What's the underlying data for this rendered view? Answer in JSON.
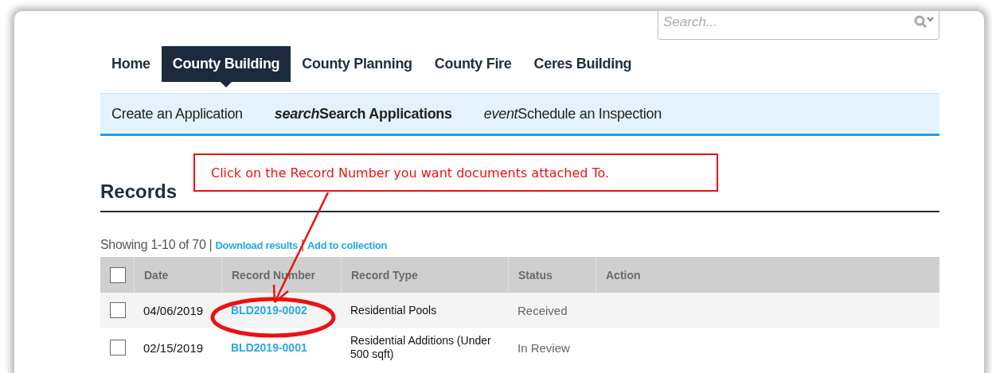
{
  "search": {
    "placeholder": "Search..."
  },
  "nav_tabs": [
    {
      "label": "Home",
      "selected": false
    },
    {
      "label": "County Building",
      "selected": true
    },
    {
      "label": "County Planning",
      "selected": false
    },
    {
      "label": "County Fire",
      "selected": false
    },
    {
      "label": "Ceres Building",
      "selected": false
    }
  ],
  "sub_nav": [
    {
      "label": "Create an Application",
      "selected": false
    },
    {
      "icon_word": "search",
      "label": "Search Applications",
      "selected": true
    },
    {
      "icon_word": "event",
      "label": "Schedule an Inspection",
      "selected": false
    }
  ],
  "records": {
    "title": "Records",
    "summary": "Showing 1-10 of 70 |",
    "links": [
      "Download results",
      "Add to collection"
    ],
    "link_separator": "|",
    "select_all_checked": false,
    "columns": [
      "Date",
      "Record Number",
      "Record Type",
      "Status",
      "Action"
    ],
    "rows": [
      {
        "checked": false,
        "date": "04/06/2019",
        "record_number": "BLD2019-0002",
        "record_type": "Residential Pools",
        "status": "Received"
      },
      {
        "checked": false,
        "date": "02/15/2019",
        "record_number": "BLD2019-0001",
        "record_type": "Residential Additions (Under 500 sqft)",
        "status": "In Review"
      }
    ]
  },
  "annotation": {
    "text": "Click on the Record Number you want documents attached To."
  }
}
